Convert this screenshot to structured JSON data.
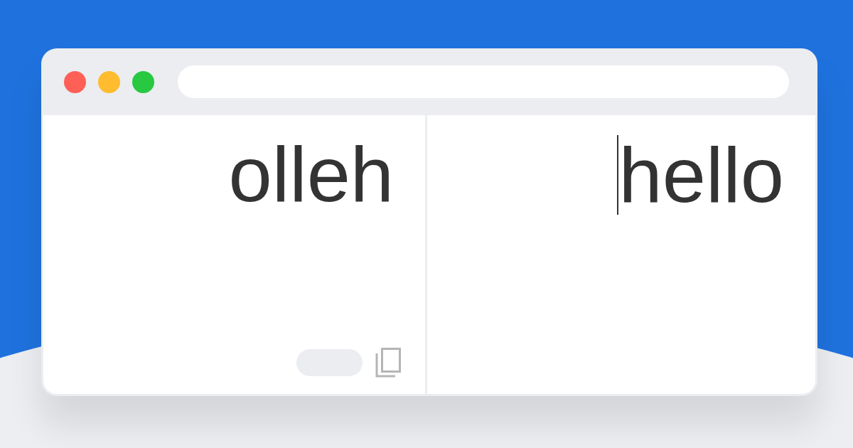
{
  "panes": [
    {
      "kind": "result",
      "text": "olleh",
      "focused": false
    },
    {
      "kind": "editor",
      "text": "hello",
      "focused": true
    }
  ]
}
